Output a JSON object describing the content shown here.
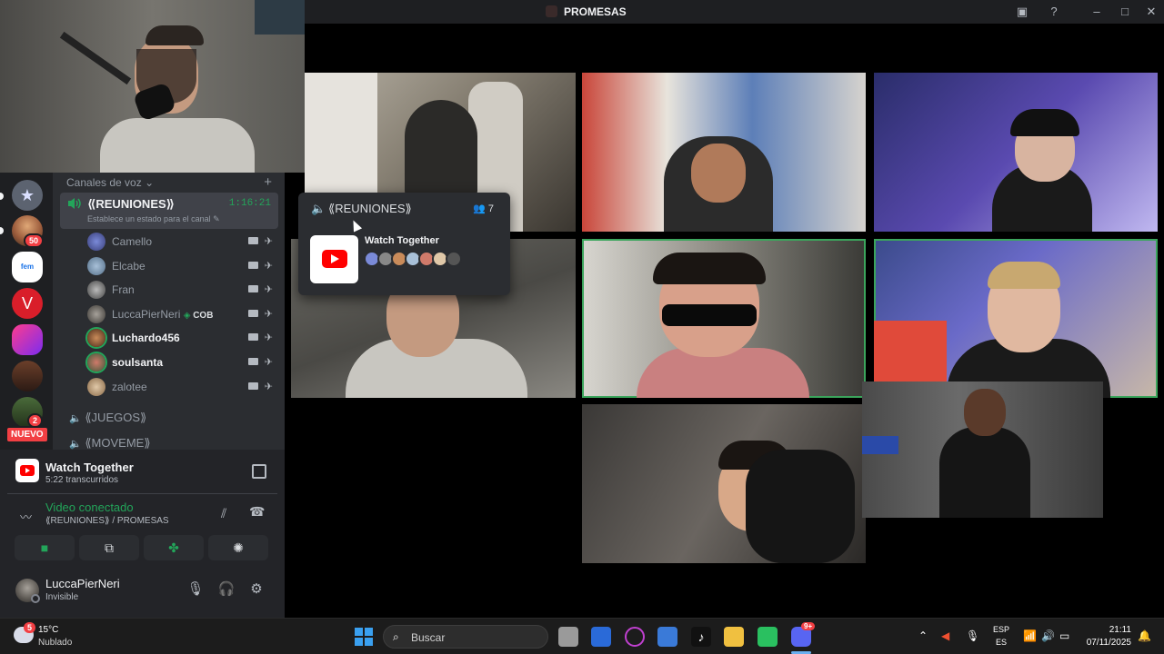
{
  "window": {
    "title": "PROMESAS"
  },
  "sidebar": {
    "voice_header": "Canales de voz",
    "active_channel": {
      "name": "⟪REUNIONES⟫",
      "timer": "1:16:21",
      "status": "Establece un estado para el canal"
    },
    "members": [
      {
        "name": "Camello",
        "bold": false
      },
      {
        "name": "Elcabe",
        "bold": false
      },
      {
        "name": "Fran",
        "bold": false
      },
      {
        "name": "LuccaPierNeri",
        "bold": false,
        "tag": "COB"
      },
      {
        "name": "Luchardo456",
        "bold": true
      },
      {
        "name": "soulsanta",
        "bold": true
      },
      {
        "name": "zalotee",
        "bold": false
      }
    ],
    "other_channels": [
      "⟪JUEGOS⟫",
      "⟪MOVEME⟫"
    ],
    "server_badges": {
      "mentions": "50",
      "dm": "2",
      "new": "NUEVO"
    }
  },
  "activity": {
    "title": "Watch Together",
    "subtitle": "5:22 transcurridos"
  },
  "voice": {
    "status": "Video conectado",
    "channel": "⟪REUNIONES⟫ / PROMESAS"
  },
  "user": {
    "name": "LuccaPierNeri",
    "status": "Invisible"
  },
  "popout": {
    "channel": "⟪REUNIONES⟫",
    "count": "7",
    "activity": "Watch Together"
  },
  "taskbar": {
    "weather_badge": "5",
    "temp": "15°C",
    "weather": "Nublado",
    "search_placeholder": "Buscar",
    "discord_badge": "9+",
    "lang_top": "ESP",
    "lang_bottom": "ES",
    "time": "21:11",
    "date": "07/11/2025"
  },
  "colors": {
    "accent_green": "#23a55a",
    "danger": "#f23f43",
    "blurple": "#5865f2"
  }
}
